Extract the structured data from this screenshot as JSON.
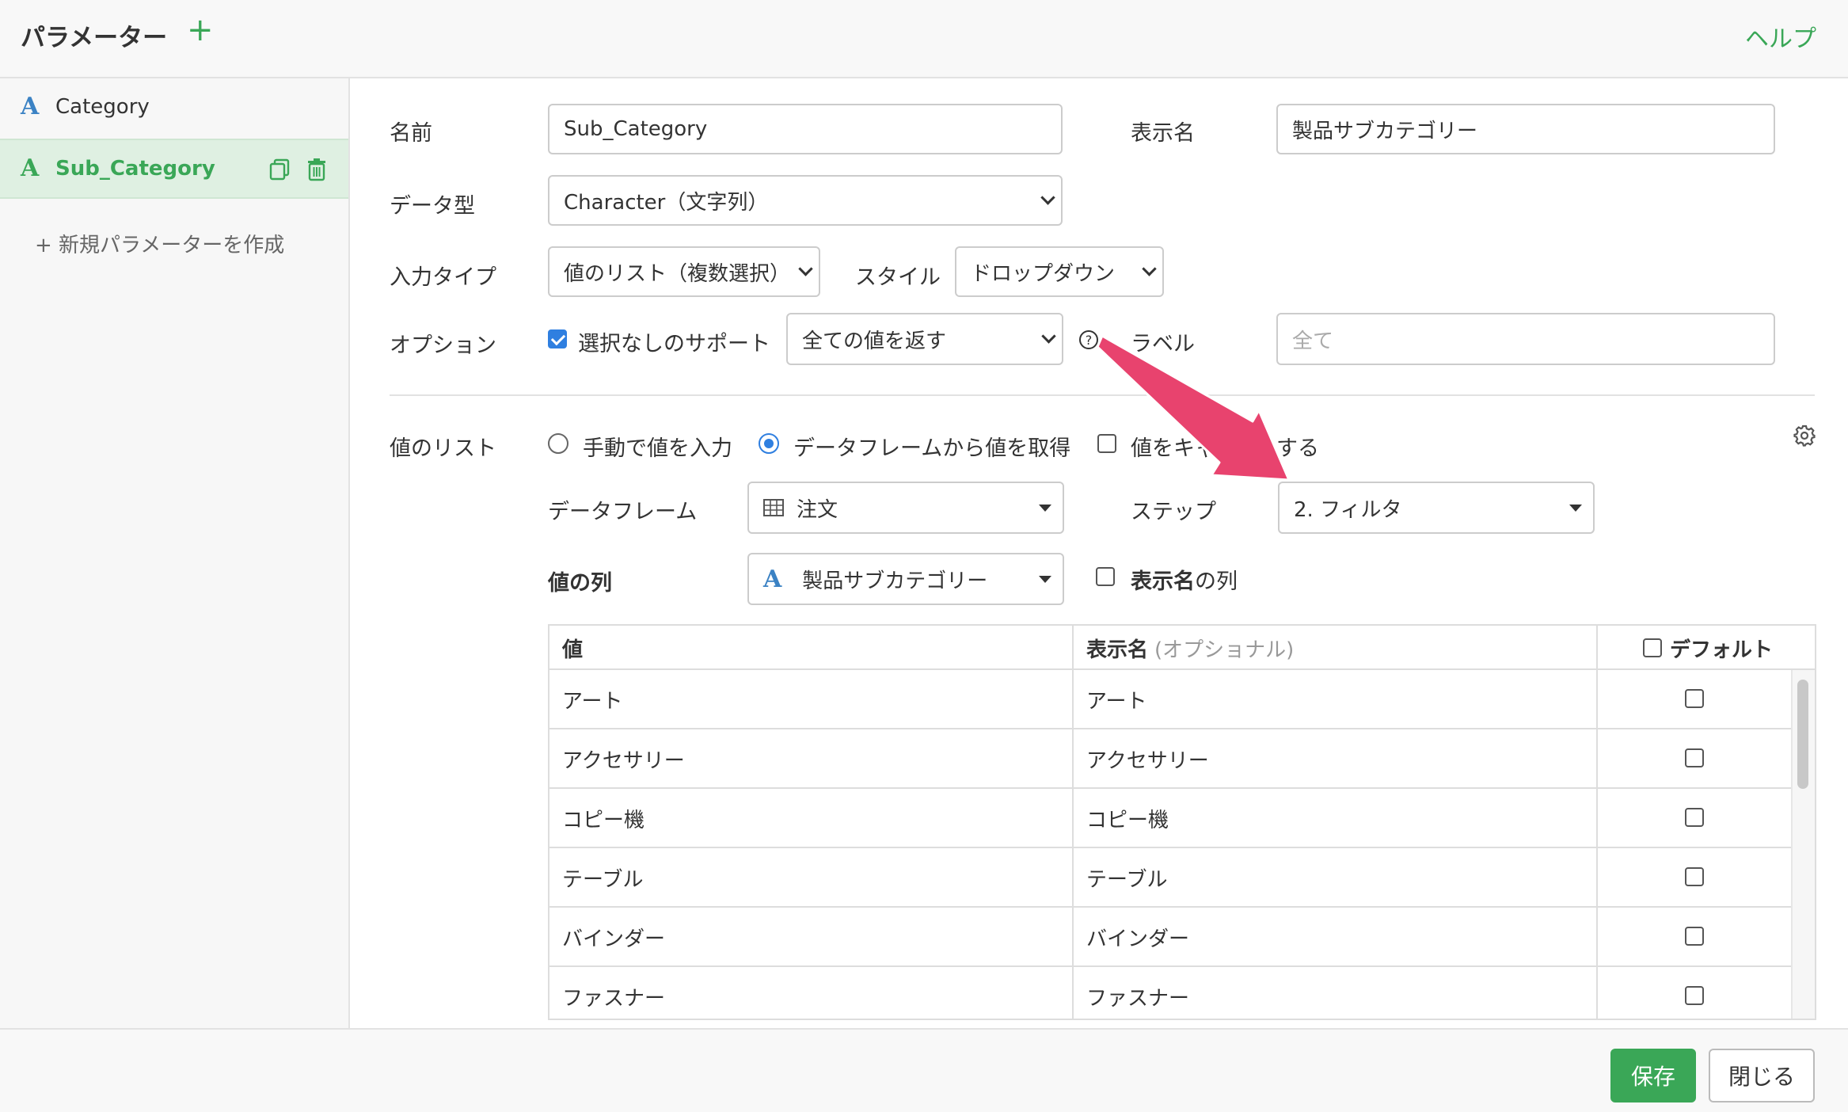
{
  "header": {
    "title": "パラメーター",
    "add": "+",
    "help": "ヘルプ"
  },
  "sidebar": {
    "items": [
      {
        "type_icon": "A",
        "label": "Category"
      },
      {
        "type_icon": "A",
        "label": "Sub_Category"
      }
    ],
    "new_label": "+ 新規パラメーターを作成"
  },
  "form": {
    "name_label": "名前",
    "name_value": "Sub_Category",
    "display_name_label": "表示名",
    "display_name_value": "製品サブカテゴリー",
    "data_type_label": "データ型",
    "data_type_value": "Character（文字列）",
    "input_type_label": "入力タイプ",
    "input_type_value": "値のリスト（複数選択）",
    "style_label": "スタイル",
    "style_value": "ドロップダウン",
    "option_label": "オプション",
    "no_selection_support": "選択なしのサポート",
    "no_selection_support_checked": true,
    "return_value": "全ての値を返す",
    "help_icon": "?",
    "label_label": "ラベル",
    "label_placeholder": "全て"
  },
  "values": {
    "section_label": "値のリスト",
    "radio_manual": "手動で値を入力",
    "radio_dataframe": "データフレームから値を取得",
    "cache_prefix": "値をキャ",
    "cache_suffix": "する",
    "dataframe_label": "データフレーム",
    "dataframe_value": "注文",
    "step_label": "ステップ",
    "step_value": "2. フィルタ",
    "value_column_label": "値の列",
    "value_column_value": "製品サブカテゴリー",
    "display_name_column_bold": "表示名",
    "display_name_column_suffix": "の列"
  },
  "table": {
    "headers": {
      "value": "値",
      "display": "表示名",
      "display_opt": "(オプショナル)",
      "default": "デフォルト"
    },
    "rows": [
      {
        "value": "アート",
        "display": "アート"
      },
      {
        "value": "アクセサリー",
        "display": "アクセサリー"
      },
      {
        "value": "コピー機",
        "display": "コピー機"
      },
      {
        "value": "テーブル",
        "display": "テーブル"
      },
      {
        "value": "バインダー",
        "display": "バインダー"
      },
      {
        "value": "ファスナー",
        "display": "ファスナー"
      }
    ]
  },
  "footer": {
    "save": "保存",
    "close": "閉じる"
  },
  "colors": {
    "accent_green": "#3aa757",
    "accent_blue": "#2f7fe0",
    "arrow_pink": "#e8436e"
  }
}
